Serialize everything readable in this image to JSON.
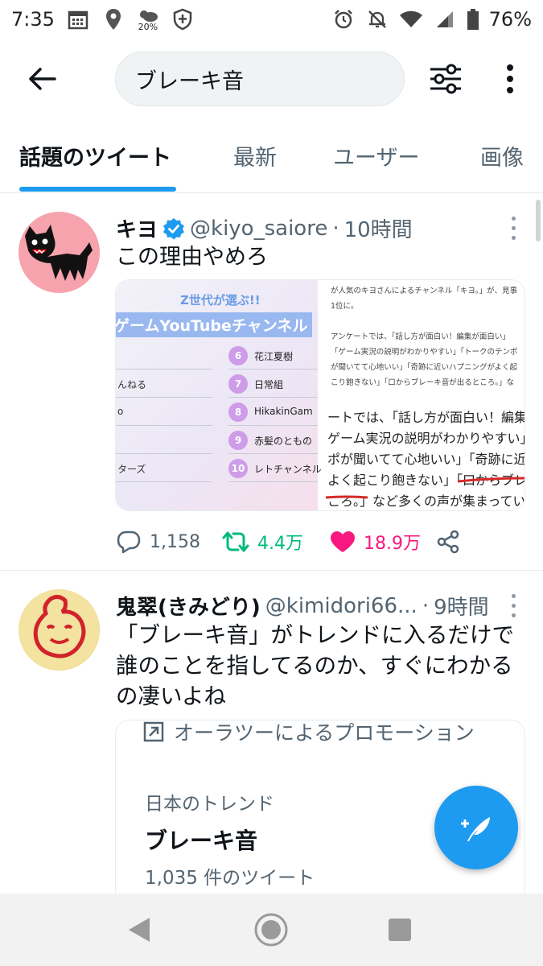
{
  "status_bar": {
    "time": "7:35",
    "weather_percent": "20%",
    "battery": "76%"
  },
  "search": {
    "query": "ブレーキ音"
  },
  "tabs": [
    {
      "label": "話題のツイート",
      "active": true
    },
    {
      "label": "最新"
    },
    {
      "label": "ユーザー"
    },
    {
      "label": "画像"
    }
  ],
  "tweets": [
    {
      "name": "キヨ",
      "handle": "@kiyo_saiore",
      "time": "10時間",
      "text": "この理由やめろ",
      "media": {
        "left_title": "Z世代が選ぶ!!",
        "left_subtitle": "ゲームYouTubeチャンネル",
        "ranks": [
          {
            "num": "6",
            "name": "花江夏樹",
            "left": ""
          },
          {
            "num": "7",
            "name": "日常組",
            "left": "んねる"
          },
          {
            "num": "8",
            "name": "HikakinGam",
            "left": "o"
          },
          {
            "num": "9",
            "name": "赤髪のともの",
            "left": ""
          },
          {
            "num": "10",
            "name": "レトチャンネル",
            "left": "ターズ"
          }
        ],
        "top_right_text": "が人気のキヨさんによるチャンネル「キヨ。」が、見事1位に。\n\nアンケートでは、「話し方が面白い！編集が面白い」「ゲーム実況の説明がわかりやすい」「トークのテンポが聞いてて心地いい」「奇跡に近いハプニングがよく起こり飽きない」「口からブレーキ音が出るところ。」など多くの声が集まっています。",
        "bottom_right_lines": [
          "ートでは、「話し方が面白い！編集が面",
          "ゲーム実況の説明がわかりやすい」「",
          "ポが聞いてて心地いい」「奇跡に近い",
          "よく起こり飽きない」「口からブレーキ",
          "ころ。」など多くの声が集まっていま"
        ]
      },
      "replies": "1,158",
      "retweets": "4.4万",
      "likes": "18.9万"
    },
    {
      "name": "鬼翠(きみどり)",
      "handle": "@kimidori66...",
      "time": "9時間",
      "text_lines": [
        "「ブレーキ音」がトレンドに入るだけで",
        "誰のことを指してるのか、すぐにわかる",
        "の凄いよね"
      ],
      "trend_card": {
        "promo": "オーラツーによるプロモーション",
        "region": "日本のトレンド",
        "topic": "ブレーキ音",
        "count": "1,035 件のツイート"
      }
    }
  ],
  "colors": {
    "accent": "#1d9bf0",
    "retweet": "#00ba7c",
    "like": "#f91880",
    "secondary_text": "#536471"
  },
  "icons": [
    "back-arrow-icon",
    "filter-sliders-icon",
    "more-vertical-icon",
    "verified-badge-icon",
    "reply-icon",
    "retweet-icon",
    "heart-icon",
    "share-icon",
    "compose-feather-icon",
    "nav-back-icon",
    "nav-home-icon",
    "nav-recents-icon"
  ]
}
